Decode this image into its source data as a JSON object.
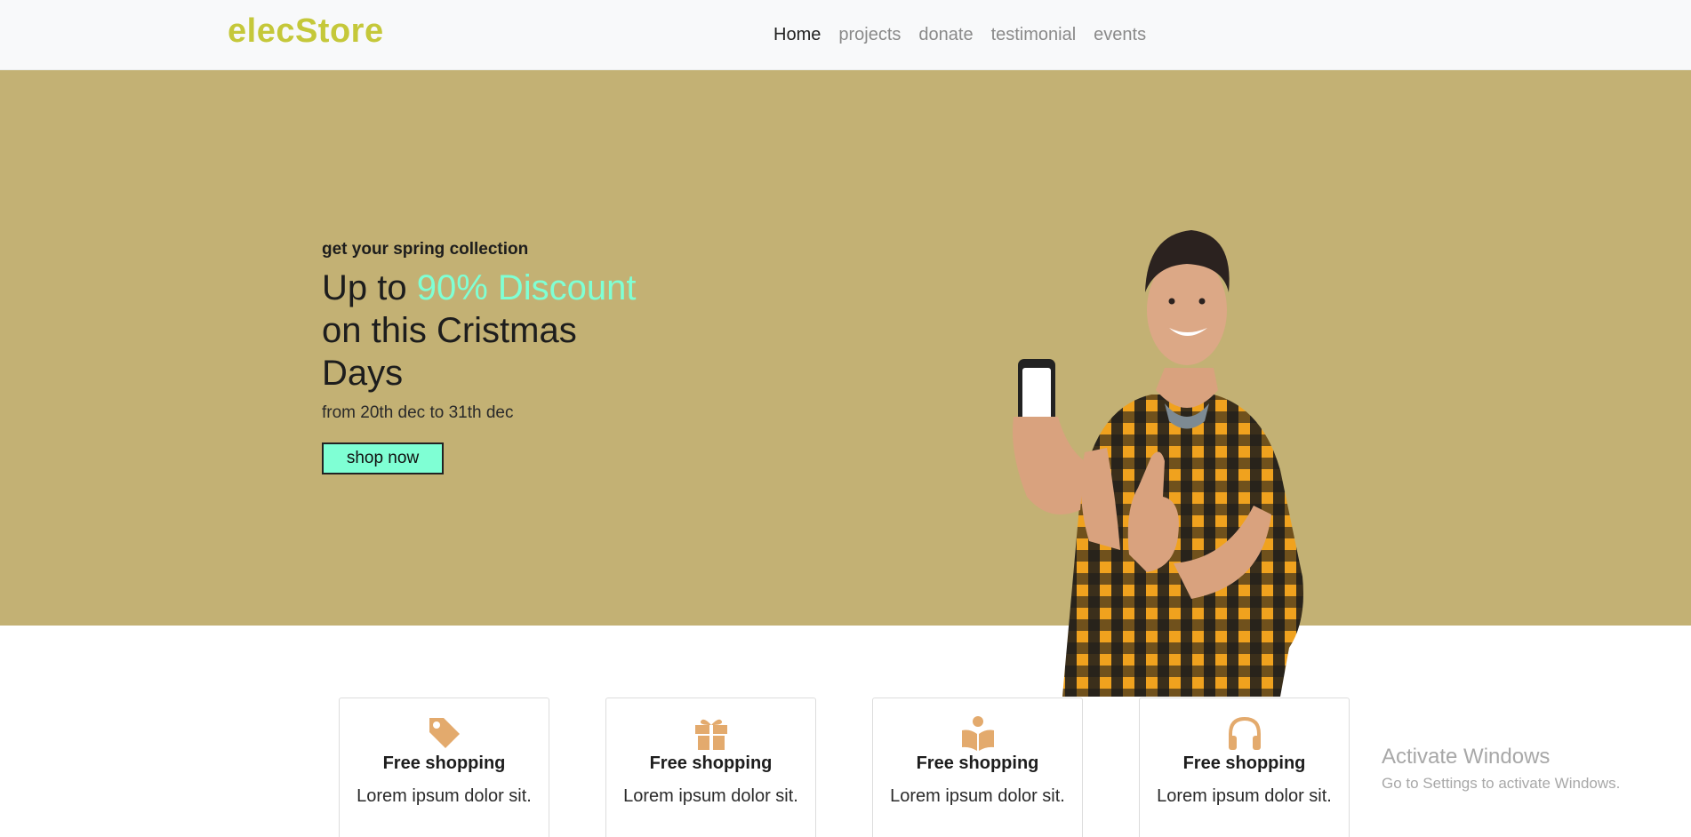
{
  "brand": {
    "name": "elecStore",
    "color": "#c5c83a"
  },
  "nav": {
    "items": [
      {
        "label": "Home",
        "active": true
      },
      {
        "label": "projects",
        "active": false
      },
      {
        "label": "donate",
        "active": false
      },
      {
        "label": "testimonial",
        "active": false
      },
      {
        "label": "events",
        "active": false
      }
    ]
  },
  "hero": {
    "background": "#c3b174",
    "kicker": "get your spring collection",
    "heading_pre": "Up to ",
    "heading_accent": "90% Discount",
    "heading_post": " on this Cristmas Days",
    "accent_color": "#7fffd4",
    "dates": "from 20th dec to 31th dec",
    "cta_label": "shop now",
    "image": "man-holding-phone-thumbs-up"
  },
  "features": [
    {
      "icon": "tag-icon",
      "title": "Free shopping",
      "text": "Lorem ipsum dolor sit."
    },
    {
      "icon": "gift-icon",
      "title": "Free shopping",
      "text": "Lorem ipsum dolor sit."
    },
    {
      "icon": "reader-icon",
      "title": "Free shopping",
      "text": "Lorem ipsum dolor sit."
    },
    {
      "icon": "headphones-icon",
      "title": "Free shopping",
      "text": "Lorem ipsum dolor sit."
    }
  ],
  "icon_color": "#e3aa6d",
  "watermark": {
    "title": "Activate Windows",
    "subtitle": "Go to Settings to activate Windows."
  }
}
